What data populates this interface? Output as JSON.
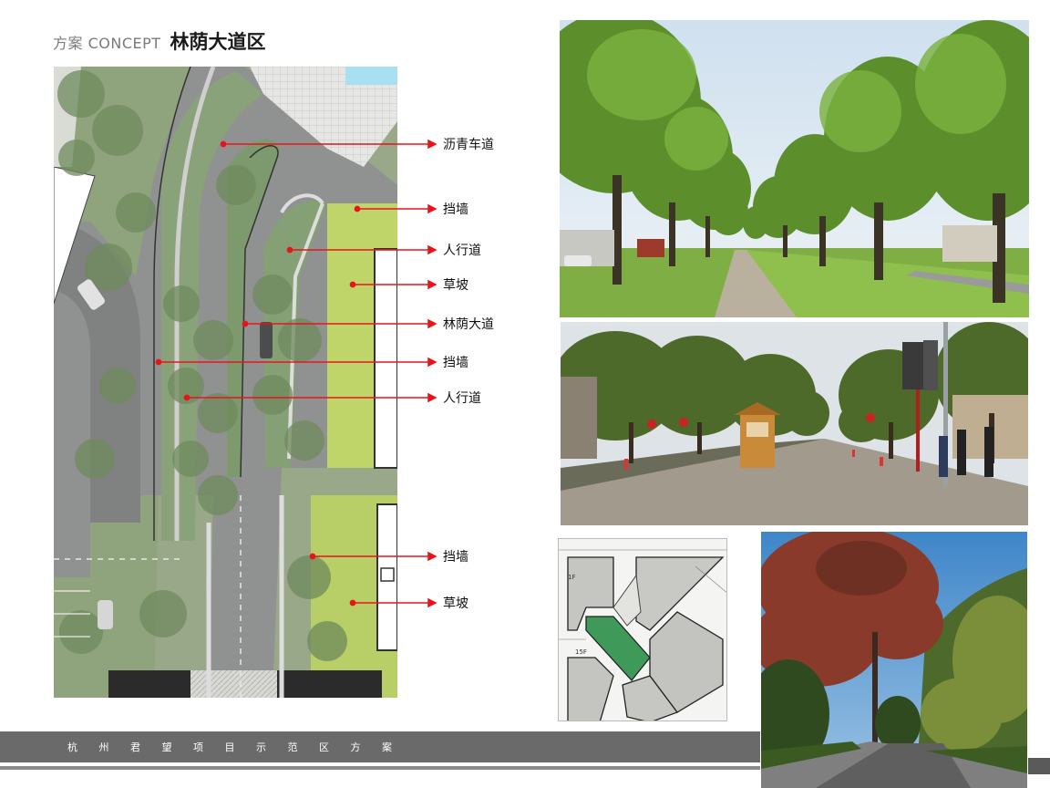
{
  "header": {
    "concept_label": "方案 CONCEPT",
    "title": "林荫大道区"
  },
  "plan": {
    "callouts": [
      {
        "label": "沥青车道"
      },
      {
        "label": "挡墙"
      },
      {
        "label": "人行道"
      },
      {
        "label": "草坡"
      },
      {
        "label": "林荫大道"
      },
      {
        "label": "挡墙"
      },
      {
        "label": "人行道"
      },
      {
        "label": "挡墙"
      },
      {
        "label": "草坡"
      }
    ],
    "key_plan_labels": [
      "1F",
      "15F"
    ]
  },
  "footer": {
    "chars": [
      "杭",
      "州",
      "君",
      "望",
      "项",
      "目",
      "示",
      "范",
      "区",
      "方",
      "案"
    ]
  },
  "colors": {
    "callout_red": "#e8141b",
    "footer_band": "#6a6a6a",
    "key_plan_highlight": "#3f9a5a"
  }
}
